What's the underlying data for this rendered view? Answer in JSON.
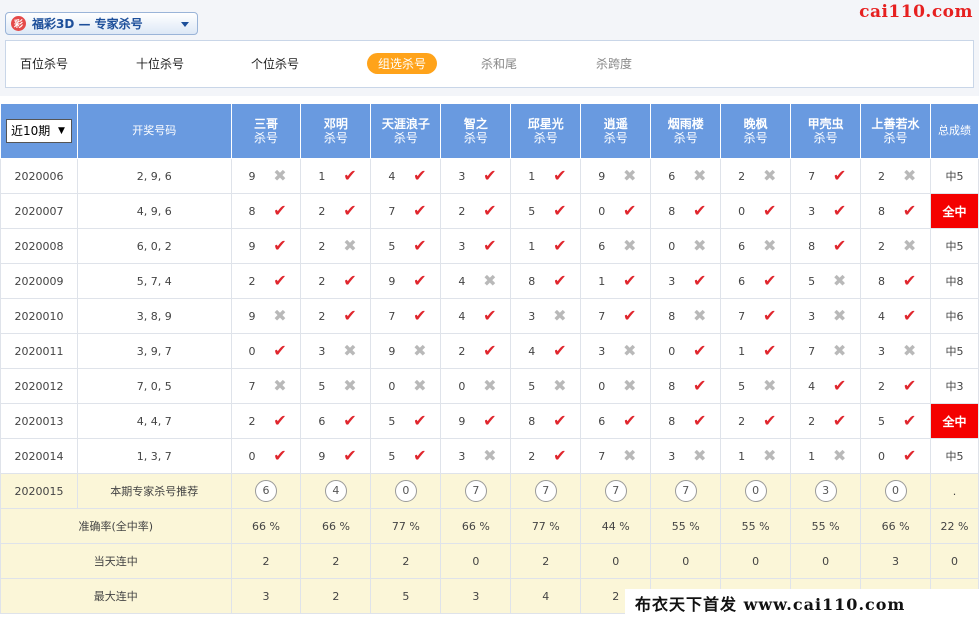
{
  "header": {
    "selector_icon": "彩",
    "selector_label": "福彩3D — 专家杀号",
    "site_logo": "cai110.com",
    "tabs": [
      {
        "label": "百位杀号",
        "state": "normal"
      },
      {
        "label": "十位杀号",
        "state": "normal"
      },
      {
        "label": "个位杀号",
        "state": "normal"
      },
      {
        "label": "组选杀号",
        "state": "active"
      },
      {
        "label": "杀和尾",
        "state": "muted"
      },
      {
        "label": "杀跨度",
        "state": "muted"
      }
    ]
  },
  "table": {
    "period_select": "近10期",
    "col_draw": "开奖号码",
    "col_total": "总成绩",
    "sub_label": "杀号",
    "experts": [
      "三哥",
      "邓明",
      "天涯浪子",
      "智之",
      "邱星光",
      "逍遥",
      "烟雨楼",
      "晚枫",
      "甲壳虫",
      "上善若水"
    ],
    "rows": [
      {
        "period": "2020006",
        "draw": "2, 9, 6",
        "result": "中5",
        "full": false,
        "picks": [
          {
            "n": "9",
            "ok": false
          },
          {
            "n": "1",
            "ok": true
          },
          {
            "n": "4",
            "ok": true
          },
          {
            "n": "3",
            "ok": true
          },
          {
            "n": "1",
            "ok": true
          },
          {
            "n": "9",
            "ok": false
          },
          {
            "n": "6",
            "ok": false
          },
          {
            "n": "2",
            "ok": false
          },
          {
            "n": "7",
            "ok": true
          },
          {
            "n": "2",
            "ok": false
          }
        ]
      },
      {
        "period": "2020007",
        "draw": "4, 9, 6",
        "result": "全中",
        "full": true,
        "picks": [
          {
            "n": "8",
            "ok": true
          },
          {
            "n": "2",
            "ok": true
          },
          {
            "n": "7",
            "ok": true
          },
          {
            "n": "2",
            "ok": true
          },
          {
            "n": "5",
            "ok": true
          },
          {
            "n": "0",
            "ok": true
          },
          {
            "n": "8",
            "ok": true
          },
          {
            "n": "0",
            "ok": true
          },
          {
            "n": "3",
            "ok": true
          },
          {
            "n": "8",
            "ok": true
          }
        ]
      },
      {
        "period": "2020008",
        "draw": "6, 0, 2",
        "result": "中5",
        "full": false,
        "picks": [
          {
            "n": "9",
            "ok": true
          },
          {
            "n": "2",
            "ok": false
          },
          {
            "n": "5",
            "ok": true
          },
          {
            "n": "3",
            "ok": true
          },
          {
            "n": "1",
            "ok": true
          },
          {
            "n": "6",
            "ok": false
          },
          {
            "n": "0",
            "ok": false
          },
          {
            "n": "6",
            "ok": false
          },
          {
            "n": "8",
            "ok": true
          },
          {
            "n": "2",
            "ok": false
          }
        ]
      },
      {
        "period": "2020009",
        "draw": "5, 7, 4",
        "result": "中8",
        "full": false,
        "picks": [
          {
            "n": "2",
            "ok": true
          },
          {
            "n": "2",
            "ok": true
          },
          {
            "n": "9",
            "ok": true
          },
          {
            "n": "4",
            "ok": false
          },
          {
            "n": "8",
            "ok": true
          },
          {
            "n": "1",
            "ok": true
          },
          {
            "n": "3",
            "ok": true
          },
          {
            "n": "6",
            "ok": true
          },
          {
            "n": "5",
            "ok": false
          },
          {
            "n": "8",
            "ok": true
          }
        ]
      },
      {
        "period": "2020010",
        "draw": "3, 8, 9",
        "result": "中6",
        "full": false,
        "picks": [
          {
            "n": "9",
            "ok": false
          },
          {
            "n": "2",
            "ok": true
          },
          {
            "n": "7",
            "ok": true
          },
          {
            "n": "4",
            "ok": true
          },
          {
            "n": "3",
            "ok": false
          },
          {
            "n": "7",
            "ok": true
          },
          {
            "n": "8",
            "ok": false
          },
          {
            "n": "7",
            "ok": true
          },
          {
            "n": "3",
            "ok": false
          },
          {
            "n": "4",
            "ok": true
          }
        ]
      },
      {
        "period": "2020011",
        "draw": "3, 9, 7",
        "result": "中5",
        "full": false,
        "picks": [
          {
            "n": "0",
            "ok": true
          },
          {
            "n": "3",
            "ok": false
          },
          {
            "n": "9",
            "ok": false
          },
          {
            "n": "2",
            "ok": true
          },
          {
            "n": "4",
            "ok": true
          },
          {
            "n": "3",
            "ok": false
          },
          {
            "n": "0",
            "ok": true
          },
          {
            "n": "1",
            "ok": true
          },
          {
            "n": "7",
            "ok": false
          },
          {
            "n": "3",
            "ok": false
          }
        ]
      },
      {
        "period": "2020012",
        "draw": "7, 0, 5",
        "result": "中3",
        "full": false,
        "picks": [
          {
            "n": "7",
            "ok": false
          },
          {
            "n": "5",
            "ok": false
          },
          {
            "n": "0",
            "ok": false
          },
          {
            "n": "0",
            "ok": false
          },
          {
            "n": "5",
            "ok": false
          },
          {
            "n": "0",
            "ok": false
          },
          {
            "n": "8",
            "ok": true
          },
          {
            "n": "5",
            "ok": false
          },
          {
            "n": "4",
            "ok": true
          },
          {
            "n": "2",
            "ok": true
          }
        ]
      },
      {
        "period": "2020013",
        "draw": "4, 4, 7",
        "result": "全中",
        "full": true,
        "picks": [
          {
            "n": "2",
            "ok": true
          },
          {
            "n": "6",
            "ok": true
          },
          {
            "n": "5",
            "ok": true
          },
          {
            "n": "9",
            "ok": true
          },
          {
            "n": "8",
            "ok": true
          },
          {
            "n": "6",
            "ok": true
          },
          {
            "n": "8",
            "ok": true
          },
          {
            "n": "2",
            "ok": true
          },
          {
            "n": "2",
            "ok": true
          },
          {
            "n": "5",
            "ok": true
          }
        ]
      },
      {
        "period": "2020014",
        "draw": "1, 3, 7",
        "result": "中5",
        "full": false,
        "picks": [
          {
            "n": "0",
            "ok": true
          },
          {
            "n": "9",
            "ok": true
          },
          {
            "n": "5",
            "ok": true
          },
          {
            "n": "3",
            "ok": false
          },
          {
            "n": "2",
            "ok": true
          },
          {
            "n": "7",
            "ok": false
          },
          {
            "n": "3",
            "ok": false
          },
          {
            "n": "1",
            "ok": false
          },
          {
            "n": "1",
            "ok": false
          },
          {
            "n": "0",
            "ok": true
          }
        ]
      }
    ],
    "recommend": {
      "period": "2020015",
      "label": "本期专家杀号推荐",
      "numbers": [
        "6",
        "4",
        "0",
        "7",
        "7",
        "7",
        "7",
        "0",
        "3",
        "0"
      ],
      "total": "."
    },
    "stats": [
      {
        "label": "准确率(全中率)",
        "values": [
          "66 %",
          "66 %",
          "77 %",
          "66 %",
          "77 %",
          "44 %",
          "55 %",
          "55 %",
          "55 %",
          "66 %"
        ],
        "total": "22 %"
      },
      {
        "label": "当天连中",
        "values": [
          "2",
          "2",
          "2",
          "0",
          "2",
          "0",
          "0",
          "0",
          "0",
          "3"
        ],
        "total": "0"
      },
      {
        "label": "最大连中",
        "values": [
          "3",
          "2",
          "5",
          "3",
          "4",
          "2",
          "",
          "",
          "",
          ""
        ],
        "total": ""
      }
    ]
  },
  "watermark": "布衣天下首发 www.cai110.com",
  "icons": {
    "hit": "check-icon",
    "miss": "cross-icon"
  },
  "colors": {
    "header": "#699ae0",
    "hit": "#e0262d",
    "miss": "#b9b9b9",
    "full": "#f40000",
    "active_tab": "#ffa31a",
    "highlight_row": "#fbf6d8"
  }
}
